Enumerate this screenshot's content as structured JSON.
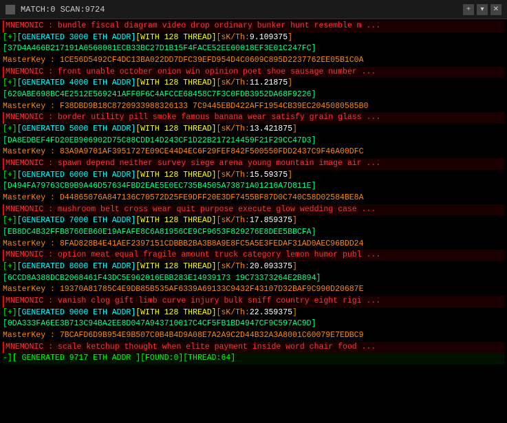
{
  "titlebar": {
    "title": "MATCH:0 SCAN:9724",
    "icon": "terminal-icon",
    "close_label": "✕",
    "add_label": "+",
    "dropdown_label": "▾"
  },
  "lines": [
    {
      "type": "mnemonic",
      "text": "MNEMONIC : bundle fiscal diagram video drop ordinary bunker hunt resemble m ..."
    },
    {
      "type": "generated",
      "text": "[+][GENERATED 3000 ETH ADDR][WITH 128 THREAD][sK/Th:9.109375]"
    },
    {
      "type": "addr",
      "text": "[37D4A466B217191A6568081ECB33BC27D1B15F4FACE52EE60018EF3E01C247FC]"
    },
    {
      "type": "masterkey",
      "text": "MasterKey : 1CE56D5492CF4DC13BA022DD7DFC39EFD954D4C0609C895D2237762EE05B1C0A"
    },
    {
      "type": "mnemonic",
      "text": "MNEMONIC : front unable october onion win opinion poet shoe sausage number ..."
    },
    {
      "type": "generated",
      "text": "[+][GENERATED 4000 ETH ADDR][WITH 128 THREAD][sK/Th:11.21875]"
    },
    {
      "type": "addr",
      "text": "[620ABE698BC4E2512E569241AFF0F6C4AFCCE68458C7F3C0FDB3952DA68F9226]"
    },
    {
      "type": "masterkey",
      "text": "MasterKey : F38DBD9B18C8720933988326133 7C9445EBD422AFF1954CB39EC2045080585B0"
    },
    {
      "type": "mnemonic",
      "text": "MNEMONIC : border utility pill smoke famous banana wear satisfy grain glass ..."
    },
    {
      "type": "generated",
      "text": "[+][GENERATED 5000 ETH ADDR][WITH 128 THREAD][sK/Th:13.421875]"
    },
    {
      "type": "addr",
      "text": "[DA8EDBEF4FD20EB906902D75C88CDD14D243CF1D22B217214459F21F29CC47D3]"
    },
    {
      "type": "masterkey",
      "text": "MasterKey : 83A9A9701AF3951727E09CE44D4EC6F29FEF842F500550FDD2437C9F46A00DFC"
    },
    {
      "type": "mnemonic",
      "text": "MNEMONIC : spawn depend neither survey siege arena young mountain image air ..."
    },
    {
      "type": "generated",
      "text": "[+][GENERATED 6000 ETH ADDR][WITH 128 THREAD][sK/Th:15.59375]"
    },
    {
      "type": "addr",
      "text": "[D494FA79763CB9B9A46D57634FBD2EAE5E0EC735B4505A73871A01216A7D811E]"
    },
    {
      "type": "masterkey",
      "text": "MasterKey : D44865076A847136C70572D25FE9DFF20E3DF7455BF87D0C740C58D02584BE8A"
    },
    {
      "type": "mnemonic",
      "text": "MNEMONIC : mushroom belt cross wear quit purpose execute glow wedding case ..."
    },
    {
      "type": "generated",
      "text": "[+][GENERATED 7000 ETH ADDR][WITH 128 THREAD][sK/Th:17.859375]"
    },
    {
      "type": "addr",
      "text": "[EB8DC4B32FFB8760EB60E19AFAFE8C6A81956CE9CF9653F829276E8DEE5BBCFA]"
    },
    {
      "type": "masterkey",
      "text": "MasterKey : 8FAD828B4E41AEF2397151CDBBB2BA3B8A9E8FC5A5E3FEDAF31AD0AEC96BDD24"
    },
    {
      "type": "mnemonic",
      "text": "MNEMONIC : option meat equal fragile amount truck category lemon humor publ ..."
    },
    {
      "type": "generated",
      "text": "[+][GENERATED 8000 ETH ADDR][WITH 128 THREAD][sK/Th:20.093375]"
    },
    {
      "type": "addr",
      "text": "[6CCD8A388DCB2068461F43DC5E962016EBB283E14939173 19C73373264E2B894]"
    },
    {
      "type": "masterkey",
      "text": "MasterKey : 19370A81785C4E9DB85B535AF6339A69133C9432F43107D32BAF9C990D20687E"
    },
    {
      "type": "mnemonic",
      "text": "MNEMONIC : vanish clog gift limb curve injury bulk sniff country eight rigi ..."
    },
    {
      "type": "generated",
      "text": "[+][GENERATED 9000 ETH ADDR][WITH 128 THREAD][sK/Th:22.359375]"
    },
    {
      "type": "addr",
      "text": "[0DA333FA6EE3B713C94BA2EE8D047A943710017C4CF5FB1BD4947CF9C597AC9D]"
    },
    {
      "type": "masterkey",
      "text": "MasterKey : 7BCAFD6D9B954E9B507C0B4B4D9A08E7A2A9C2D44B32A3A8001C60079E7EDBC9"
    },
    {
      "type": "mnemonic",
      "text": "MNEMONIC : scale ketchup thought when elite payment inside word chair food ..."
    },
    {
      "type": "status",
      "text": "-][ GENERATED 9717 ETH ADDR ][FOUND:0][THREAD:64]"
    }
  ]
}
